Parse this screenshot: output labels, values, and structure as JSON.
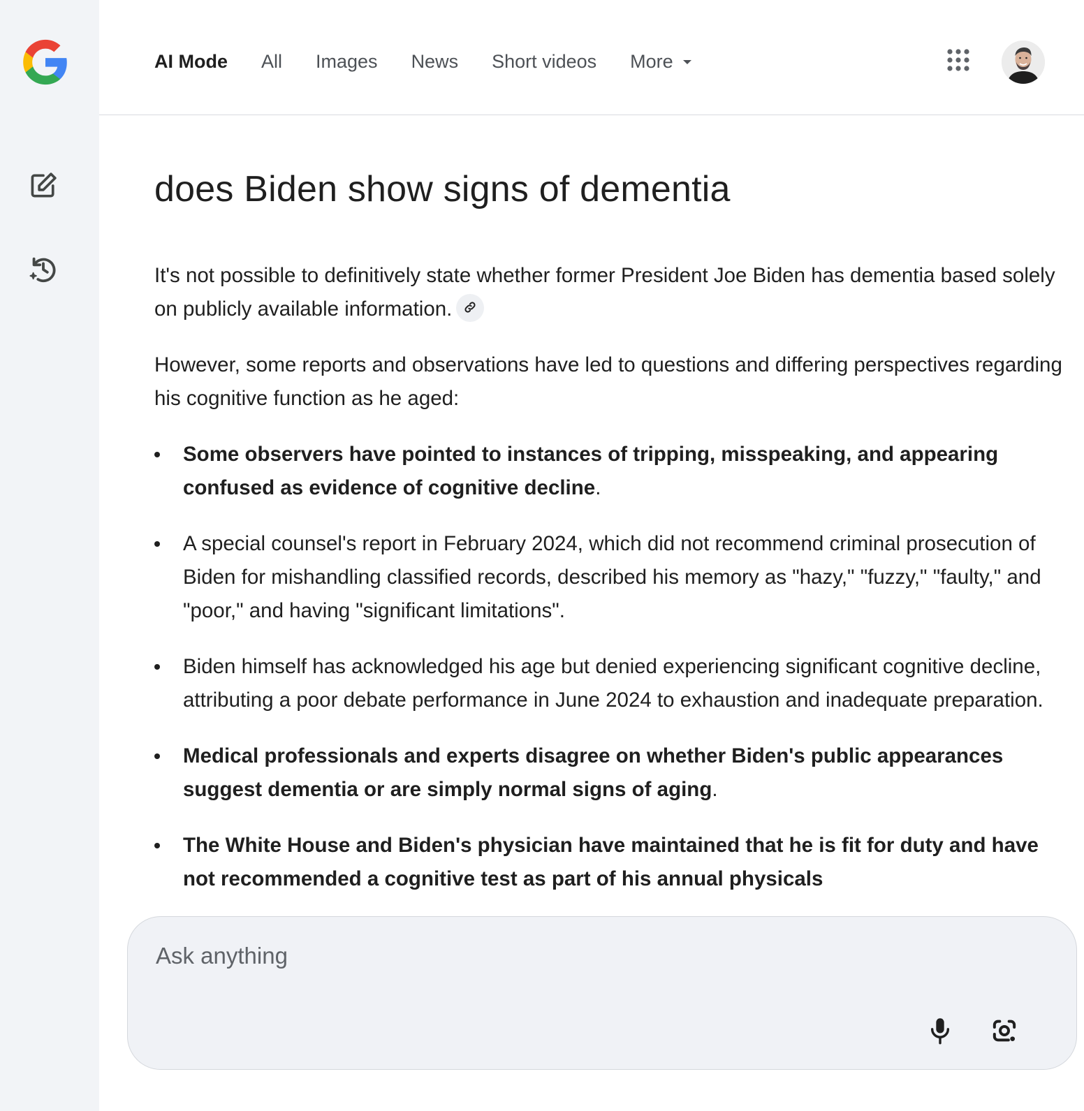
{
  "app": {
    "logo_icon": "google-g-logo",
    "brand_colors": {
      "blue": "#4285F4",
      "red": "#EA4335",
      "yellow": "#FBBC05",
      "green": "#34A853"
    }
  },
  "sidebar": {
    "items": [
      {
        "icon": "edit-square-icon",
        "label": ""
      },
      {
        "icon": "history-icon",
        "label": ""
      }
    ]
  },
  "header": {
    "tabs": [
      {
        "label": "AI Mode",
        "active": true
      },
      {
        "label": "All",
        "active": false
      },
      {
        "label": "Images",
        "active": false
      },
      {
        "label": "News",
        "active": false
      },
      {
        "label": "Short videos",
        "active": false
      },
      {
        "label": "More",
        "active": false,
        "dropdown": true
      }
    ],
    "apps_icon": "apps-grid-icon",
    "avatar_icon": "user-avatar"
  },
  "main": {
    "query": "does Biden show signs of dementia",
    "paragraphs": [
      "It's not possible to definitively state whether former President Joe Biden has dementia based solely on publicly available information.",
      "However, some reports and observations have led to questions and differing perspectives regarding his cognitive function as he aged:"
    ],
    "source_link_icon": "link-icon",
    "bullets": [
      {
        "text": "Some observers have pointed to instances of tripping, misspeaking, and appearing confused as evidence of cognitive decline",
        "suffix": ".",
        "bold": true
      },
      {
        "text": "A special counsel's report in February 2024, which did not recommend criminal prosecution of Biden for mishandling classified records, described his memory as \"hazy,\" \"fuzzy,\" \"faulty,\" and \"poor,\" and having \"significant limitations\".",
        "suffix": "",
        "bold": false
      },
      {
        "text": "Biden himself has acknowledged his age but denied experiencing significant cognitive decline, attributing a poor debate performance in June 2024 to exhaustion and inadequate preparation.",
        "suffix": "",
        "bold": false
      },
      {
        "text": "Medical professionals and experts disagree on whether Biden's public appearances suggest dementia or are simply normal signs of aging",
        "suffix": ".",
        "bold": true
      },
      {
        "text": "The White House and Biden's physician have maintained that he is fit for duty and have not recommended a cognitive test as part of his annual physicals",
        "suffix": "",
        "bold": true
      }
    ]
  },
  "ask": {
    "placeholder": "Ask anything",
    "value": "",
    "mic_icon": "microphone-icon",
    "lens_icon": "camera-lens-icon"
  }
}
